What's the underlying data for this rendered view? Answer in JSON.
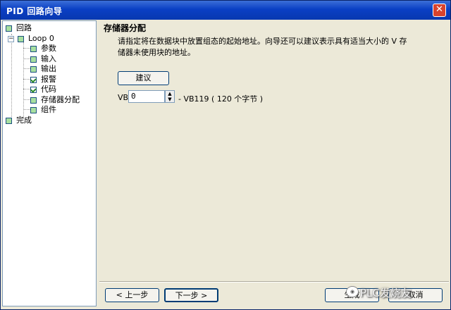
{
  "window": {
    "title": "PID 回路向导"
  },
  "tree": [
    {
      "label": "回路",
      "level": 0,
      "checked": false
    },
    {
      "label": "Loop 0",
      "level": 1,
      "checked": false
    },
    {
      "label": "参数",
      "level": 2,
      "checked": false
    },
    {
      "label": "输入",
      "level": 2,
      "checked": false
    },
    {
      "label": "输出",
      "level": 2,
      "checked": false
    },
    {
      "label": "报警",
      "level": 2,
      "checked": true
    },
    {
      "label": "代码",
      "level": 2,
      "checked": true
    },
    {
      "label": "存储器分配",
      "level": 2,
      "checked": false
    },
    {
      "label": "组件",
      "level": 2,
      "checked": false
    },
    {
      "label": "完成",
      "level": 0,
      "checked": false
    }
  ],
  "content": {
    "section_title": "存储器分配",
    "description": "请指定将在数据块中放置组态的起始地址。向导还可以建议表示具有适当大小的 V 存储器未使用块的地址。",
    "suggest_button": "建议",
    "vb_label": "VB",
    "vb_value": "0",
    "vb_range": "- VB119 ( 120 个字节 )"
  },
  "footer": {
    "prev_button": "< 上一步",
    "next_button": "下一步 >",
    "finish_button": "生成",
    "cancel_button": "取消"
  },
  "watermark": "PLC发烧友",
  "colors": {
    "titlebar": "#0a3fc4",
    "dialog_bg": "#ece9d8",
    "close": "#d8432e"
  }
}
